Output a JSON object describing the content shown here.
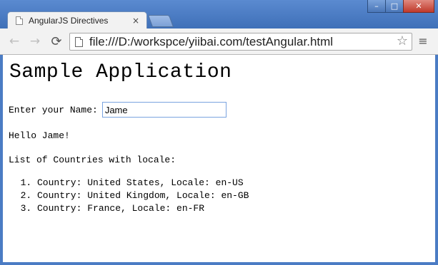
{
  "browser": {
    "tab_title": "AngularJS Directives",
    "tab_close": "×",
    "url": "file:///D:/workspce/yiibai.com/testAngular.html",
    "window_controls": {
      "minimize": "–",
      "maximize": "□",
      "close": "✕"
    },
    "nav": {
      "back": "←",
      "forward": "→",
      "reload": "⟳",
      "star": "☆",
      "menu": "≡"
    }
  },
  "page": {
    "heading": "Sample Application",
    "name_label": "Enter your Name:",
    "name_value": "Jame",
    "greeting": "Hello Jame!",
    "list_title": "List of Countries with locale:",
    "countries": [
      "Country: United States, Locale: en-US",
      "Country: United Kingdom, Locale: en-GB",
      "Country: France, Locale: en-FR"
    ]
  }
}
